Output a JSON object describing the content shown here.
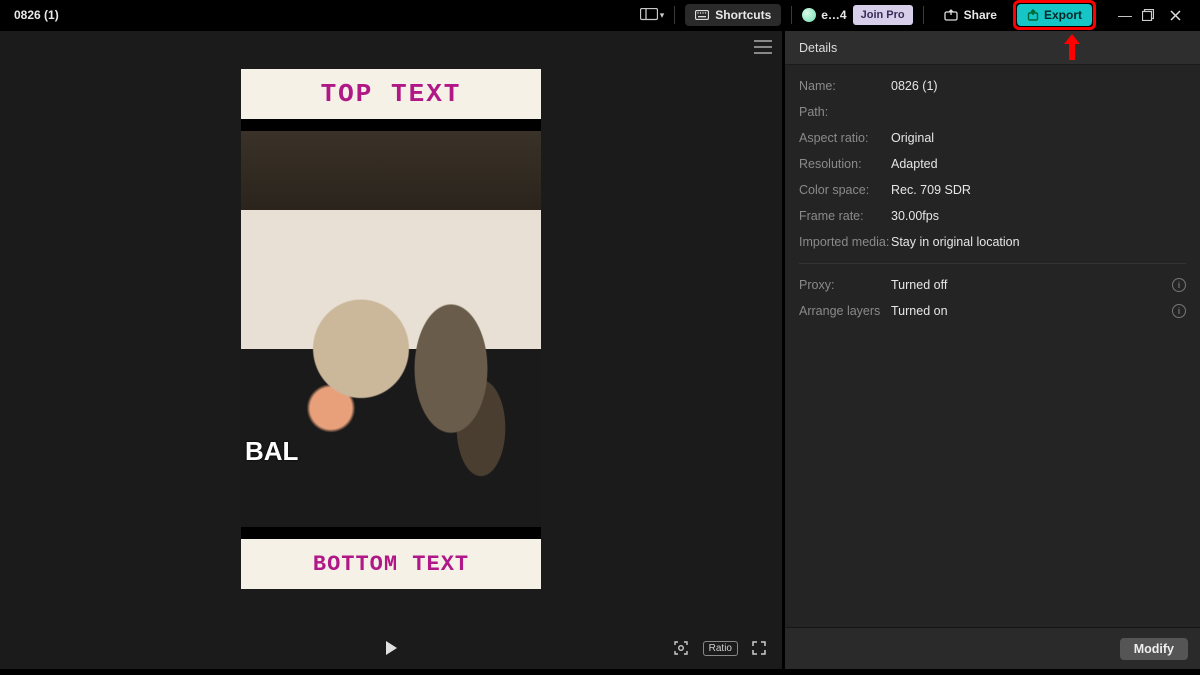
{
  "topbar": {
    "project_title": "0826 (1)",
    "shortcuts_label": "Shortcuts",
    "user_label": "e…4",
    "join_pro_label": "Join Pro",
    "share_label": "Share",
    "export_label": "Export"
  },
  "preview": {
    "meme_top_text": "TOP TEXT",
    "meme_bottom_text": "BOTTOM TEXT",
    "photo_overlay_text": "BAL",
    "ratio_chip": "Ratio"
  },
  "details": {
    "header": "Details",
    "rows": {
      "name_label": "Name:",
      "name_value": "0826 (1)",
      "path_label": "Path:",
      "path_value": "",
      "aspect_label": "Aspect ratio:",
      "aspect_value": "Original",
      "resolution_label": "Resolution:",
      "resolution_value": "Adapted",
      "colorspace_label": "Color space:",
      "colorspace_value": "Rec. 709 SDR",
      "framerate_label": "Frame rate:",
      "framerate_value": "30.00fps",
      "imported_label": "Imported media:",
      "imported_value": "Stay in original location",
      "proxy_label": "Proxy:",
      "proxy_value": "Turned off",
      "arrange_label": "Arrange layers",
      "arrange_value": "Turned on"
    },
    "modify_label": "Modify"
  }
}
